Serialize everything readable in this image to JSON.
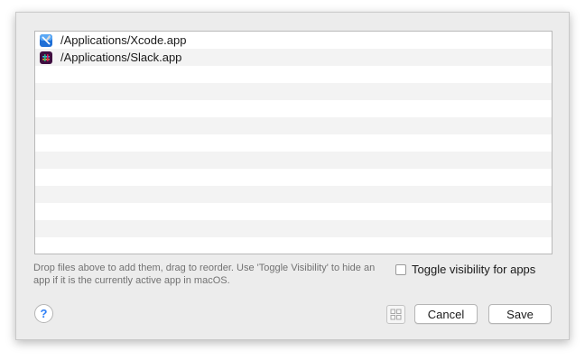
{
  "files": [
    {
      "path": "/Applications/Xcode.app",
      "icon": "xcode-icon"
    },
    {
      "path": "/Applications/Slack.app",
      "icon": "slack-icon"
    }
  ],
  "hint_text": "Drop files above to add them, drag to reorder. Use 'Toggle Visibility' to hide an app if it is the currently active app in macOS.",
  "toggle": {
    "label": "Toggle visibility for apps",
    "checked": false
  },
  "help": {
    "label": "?"
  },
  "buttons": {
    "cancel": "Cancel",
    "save": "Save"
  },
  "colors": {
    "accent": "#2d7ff6",
    "row_alt": "#f3f3f3",
    "sheet_bg": "#ececec"
  }
}
